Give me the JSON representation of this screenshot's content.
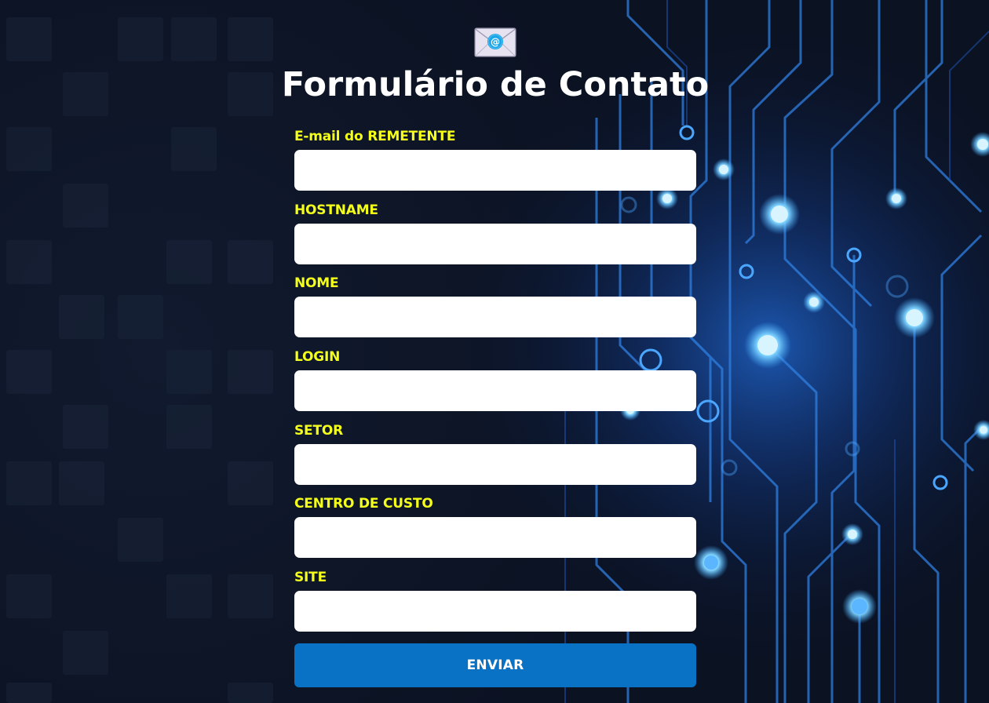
{
  "form": {
    "title": "Formulário de Contato",
    "logo_icon": "envelope-at-icon",
    "fields": [
      {
        "label": "E-mail do REMETENTE",
        "value": ""
      },
      {
        "label": "HOSTNAME",
        "value": ""
      },
      {
        "label": "NOME",
        "value": ""
      },
      {
        "label": "LOGIN",
        "value": ""
      },
      {
        "label": "SETOR",
        "value": ""
      },
      {
        "label": "CENTRO DE CUSTO",
        "value": ""
      },
      {
        "label": "SITE",
        "value": ""
      }
    ],
    "submit_label": "ENVIAR"
  },
  "colors": {
    "background": "#0c1427",
    "label": "#f4ff1a",
    "title": "#ffffff",
    "button": "#0a72c4",
    "circuit_glow": "#3fb8ff"
  }
}
